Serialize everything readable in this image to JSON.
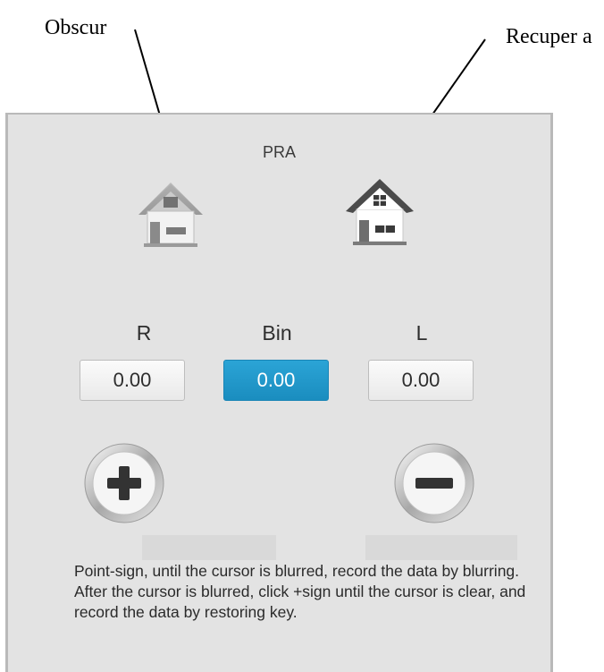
{
  "callouts": {
    "obscure": "Obscur",
    "recover": "Recuper a"
  },
  "dialog": {
    "title": "PRA",
    "columns": [
      {
        "label": "R",
        "value": "0.00",
        "active": false
      },
      {
        "label": "Bin",
        "value": "0.00",
        "active": true
      },
      {
        "label": "L",
        "value": "0.00",
        "active": false
      }
    ],
    "plus_button": "+",
    "minus_button": "−",
    "instructions": "Point-sign, until the cursor is blurred, record the data by blurring. After the cursor is blurred, click +sign until the cursor is clear, and record the data by restoring key."
  },
  "icons": {
    "obscure_house": "house-obscured-icon",
    "recover_house": "house-clear-icon",
    "plus": "plus-icon",
    "minus": "minus-icon"
  },
  "colors": {
    "dialog_bg": "#e3e3e3",
    "active_value": "#1a8dbf",
    "house_roof_clear": "#4a4a4a",
    "house_body": "#ffffff"
  }
}
